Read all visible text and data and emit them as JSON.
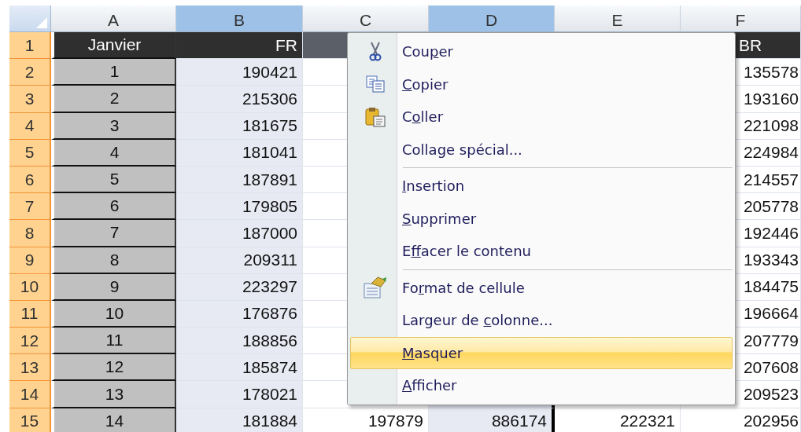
{
  "columns": [
    {
      "label": "A",
      "selected": false
    },
    {
      "label": "B",
      "selected": true
    },
    {
      "label": "C",
      "selected": false
    },
    {
      "label": "D",
      "selected": true
    },
    {
      "label": "E",
      "selected": false
    },
    {
      "label": "F",
      "selected": false
    }
  ],
  "rows": [
    {
      "header": "1",
      "kind": "heading",
      "cells": [
        "Janvier",
        "FR",
        "",
        "",
        "",
        "BR"
      ]
    },
    {
      "header": "2",
      "kind": "data",
      "cells": [
        "1",
        "190421",
        "",
        "",
        "",
        "135578"
      ]
    },
    {
      "header": "3",
      "kind": "data",
      "cells": [
        "2",
        "215306",
        "",
        "",
        "",
        "193160"
      ]
    },
    {
      "header": "4",
      "kind": "data",
      "cells": [
        "3",
        "181675",
        "",
        "",
        "",
        "221098"
      ]
    },
    {
      "header": "5",
      "kind": "data",
      "cells": [
        "4",
        "181041",
        "",
        "",
        "",
        "224984"
      ]
    },
    {
      "header": "6",
      "kind": "data",
      "cells": [
        "5",
        "187891",
        "",
        "",
        "",
        "214557"
      ]
    },
    {
      "header": "7",
      "kind": "data",
      "cells": [
        "6",
        "179805",
        "",
        "",
        "",
        "205778"
      ]
    },
    {
      "header": "8",
      "kind": "data",
      "cells": [
        "7",
        "187000",
        "",
        "",
        "",
        "192446"
      ]
    },
    {
      "header": "9",
      "kind": "data",
      "cells": [
        "8",
        "209311",
        "",
        "",
        "",
        "193343"
      ]
    },
    {
      "header": "10",
      "kind": "data",
      "cells": [
        "9",
        "223297",
        "",
        "",
        "",
        "184475"
      ]
    },
    {
      "header": "11",
      "kind": "data",
      "cells": [
        "10",
        "176876",
        "",
        "",
        "",
        "196664"
      ]
    },
    {
      "header": "12",
      "kind": "data",
      "cells": [
        "11",
        "188856",
        "",
        "",
        "",
        "207779"
      ]
    },
    {
      "header": "13",
      "kind": "data",
      "cells": [
        "12",
        "185874",
        "",
        "",
        "",
        "207608"
      ]
    },
    {
      "header": "14",
      "kind": "data",
      "cells": [
        "13",
        "178021",
        "",
        "",
        "",
        "209523"
      ]
    },
    {
      "header": "15",
      "kind": "data",
      "cells": [
        "14",
        "181884",
        "197879",
        "886174",
        "222321",
        "202956"
      ]
    }
  ],
  "context_menu": {
    "items": [
      {
        "label": {
          "before": "Cou",
          "key": "p",
          "after": "er"
        },
        "separator_before": false,
        "selected": false
      },
      {
        "label": {
          "key": "C",
          "after": "opier"
        },
        "separator_before": false,
        "selected": false
      },
      {
        "label": {
          "before": "C",
          "key": "o",
          "after": "ller"
        },
        "separator_before": false,
        "selected": false
      },
      {
        "label": {
          "before": "Colla",
          "key": "g",
          "after": "e spécial..."
        },
        "separator_before": false,
        "selected": false
      },
      {
        "label": {
          "key": "I",
          "after": "nsertion"
        },
        "separator_before": true,
        "selected": false
      },
      {
        "label": {
          "key": "S",
          "after": "upprimer"
        },
        "separator_before": false,
        "selected": false
      },
      {
        "label": {
          "before": "E",
          "key": "f",
          "after": "facer le contenu"
        },
        "separator_before": false,
        "selected": false
      },
      {
        "label": {
          "before": "Fo",
          "key": "r",
          "after": "mat de cellule"
        },
        "separator_before": true,
        "selected": false
      },
      {
        "label": {
          "before": "Largeur de ",
          "key": "c",
          "after": "olonne..."
        },
        "separator_before": false,
        "selected": false
      },
      {
        "label": {
          "key": "M",
          "after": "asquer"
        },
        "separator_before": false,
        "selected": true
      },
      {
        "label": {
          "key": "A",
          "after": "fficher"
        },
        "separator_before": false,
        "selected": false
      }
    ]
  }
}
